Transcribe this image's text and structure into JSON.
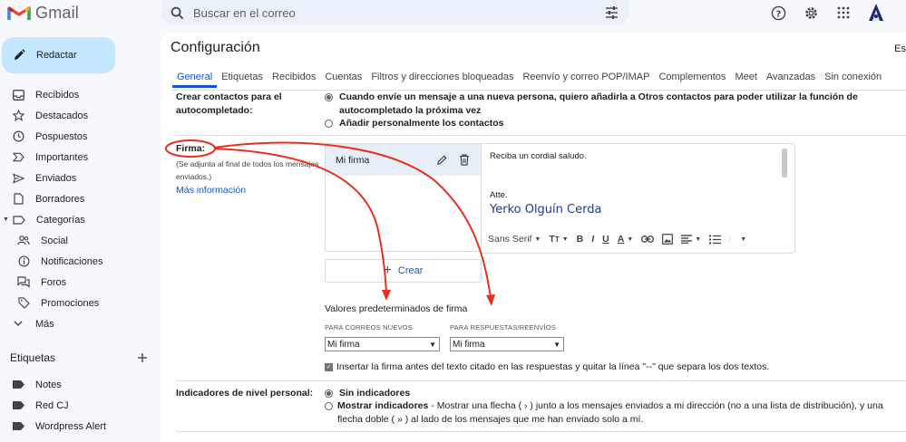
{
  "app": {
    "name": "Gmail"
  },
  "search": {
    "placeholder": "Buscar en el correo"
  },
  "compose": {
    "label": "Redactar"
  },
  "sidebar": {
    "items": [
      {
        "label": "Recibidos",
        "icon": "inbox-icon"
      },
      {
        "label": "Destacados",
        "icon": "star-icon"
      },
      {
        "label": "Pospuestos",
        "icon": "clock-icon"
      },
      {
        "label": "Importantes",
        "icon": "important-icon"
      },
      {
        "label": "Enviados",
        "icon": "send-icon"
      },
      {
        "label": "Borradores",
        "icon": "draft-icon"
      },
      {
        "label": "Categorías",
        "icon": "label-icon"
      },
      {
        "label": "Social",
        "icon": "people-icon"
      },
      {
        "label": "Notificaciones",
        "icon": "info-icon"
      },
      {
        "label": "Foros",
        "icon": "forum-icon"
      },
      {
        "label": "Promociones",
        "icon": "tag-icon"
      },
      {
        "label": "Más",
        "icon": "chevron-down-icon"
      }
    ],
    "labels_title": "Etiquetas",
    "labels": [
      "Notes",
      "Red CJ",
      "Wordpress Alert"
    ]
  },
  "settings": {
    "title": "Configuración",
    "title_right": "Es",
    "tabs": [
      "General",
      "Etiquetas",
      "Recibidos",
      "Cuentas",
      "Filtros y direcciones bloqueadas",
      "Reenvío y correo POP/IMAP",
      "Complementos",
      "Meet",
      "Avanzadas",
      "Sin conexión"
    ],
    "contacts": {
      "label": "Crear contactos para el autocompletado:",
      "option1": "Cuando envíe un mensaje a una nueva persona, quiero añadirla a Otros contactos para poder utilizar la función de autocompletado la próxima vez",
      "option2": "Añadir personalmente los contactos"
    },
    "signature": {
      "label": "Firma:",
      "note": "(Se adjunta al final de todos los mensajes enviados.)",
      "link": "Más información",
      "item_name": "Mi firma",
      "create_label": "Crear",
      "editor_line1": "Reciba un cordial saludo.",
      "editor_line2": "Atte.",
      "editor_signature": "Yerko Olguín Cerda",
      "font_label": "Sans Serif",
      "defaults_title": "Valores predeterminados de firma",
      "new_caption": "PARA CORREOS NUEVOS",
      "reply_caption": "PARA RESPUESTAS/REENVÍOS",
      "new_value": "Mi firma",
      "reply_value": "Mi firma",
      "checkbox_label": "Insertar la firma antes del texto citado en las respuestas y quitar la línea \"--\" que separa los dos textos.",
      "checkbox_checked": true
    },
    "indicators": {
      "label": "Indicadores de nivel personal:",
      "option1": "Sin indicadores",
      "option2_bold": "Mostrar indicadores",
      "option2_rest": " - Mostrar una flecha ( › ) junto a los mensajes enviados a mi dirección (no a una lista de distribución), y una flecha doble ( » ) al lado de los mensajes que me han enviado solo a mí."
    }
  },
  "colors": {
    "accent": "#0b57d0",
    "annotation": "#e8321d",
    "compose_bg": "#c2e7ff"
  }
}
